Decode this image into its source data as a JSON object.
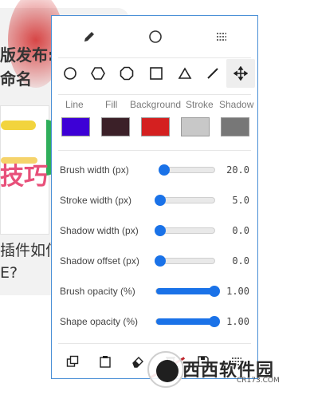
{
  "background": {
    "title_lines": [
      "版发布:",
      "命名"
    ],
    "pink_text": "技巧",
    "question_lines": [
      "插件如何",
      "E?"
    ]
  },
  "toolbar_tabs": [
    {
      "icon": "pencil-icon"
    },
    {
      "icon": "circle-icon"
    },
    {
      "icon": "options-icon"
    }
  ],
  "tools": [
    {
      "icon": "circle-tool-icon",
      "active": false
    },
    {
      "icon": "hexagon-tool-icon",
      "active": false
    },
    {
      "icon": "octagon-tool-icon",
      "active": false
    },
    {
      "icon": "square-tool-icon",
      "active": false
    },
    {
      "icon": "triangle-tool-icon",
      "active": false
    },
    {
      "icon": "line-tool-icon",
      "active": false
    },
    {
      "icon": "move-tool-icon",
      "active": true
    }
  ],
  "colors": {
    "labels": [
      "Line",
      "Fill",
      "Background",
      "Stroke",
      "Shadow"
    ],
    "swatches": [
      "#3d00d6",
      "#3b2028",
      "#d42020",
      "#c8c8c8",
      "#777777"
    ]
  },
  "sliders": [
    {
      "label": "Brush width (px)",
      "value": "20.0",
      "fraction": 0.08
    },
    {
      "label": "Stroke width (px)",
      "value": "5.0",
      "fraction": 0.0
    },
    {
      "label": "Shadow width (px)",
      "value": "0.0",
      "fraction": 0.0
    },
    {
      "label": "Shadow offset (px)",
      "value": "0.0",
      "fraction": 0.0
    },
    {
      "label": "Brush opacity (%)",
      "value": "1.00",
      "fraction": 1.0
    },
    {
      "label": "Shape opacity (%)",
      "value": "1.00",
      "fraction": 1.0
    }
  ],
  "bottom_buttons": [
    {
      "icon": "copy-icon"
    },
    {
      "icon": "paste-icon"
    },
    {
      "icon": "eraser-icon"
    },
    {
      "icon": "trash-icon"
    },
    {
      "icon": "save-icon"
    },
    {
      "icon": "more-icon"
    }
  ],
  "watermark": {
    "text": "西西软件园",
    "subtext": "CR173.COM"
  },
  "accent_color": "#1a72e8"
}
